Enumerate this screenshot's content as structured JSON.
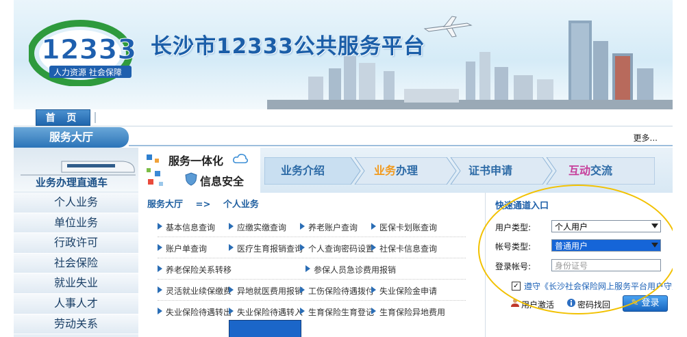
{
  "header": {
    "logo_number": "12333",
    "logo_tagline": "人力资源  社会保障",
    "site_title": "长沙市12333公共服务平台"
  },
  "nav": {
    "home": "首 页"
  },
  "hall": {
    "title": "服务大厅",
    "more": "更多..."
  },
  "sidebar": {
    "train_label": "业务办理直通车",
    "items": [
      "个人业务",
      "单位业务",
      "行政许可",
      "社会保险",
      "就业失业",
      "人事人才",
      "劳动关系"
    ]
  },
  "strip": {
    "badge_line1": "服务一体化",
    "badge_line2": "信息安全",
    "steps": [
      {
        "a": "业务",
        "b": "介绍",
        "hl": false
      },
      {
        "a": "业务",
        "b": "办理",
        "hl": true
      },
      {
        "a": "证书",
        "b": "申请",
        "hl": false
      },
      {
        "a": "互动",
        "b": "交流",
        "hl": false
      }
    ]
  },
  "breadcrumb": {
    "root": "服务大厅",
    "arrow": "=>",
    "current": "个人业务"
  },
  "services": [
    [
      "基本信息查询",
      "应缴实缴查询",
      "养老账户查询",
      "医保卡划账查询"
    ],
    [
      "账户单查询",
      "医疗生育报销查询",
      "个人查询密码设置",
      "社保卡信息查询"
    ],
    [
      "养老保险关系转移",
      "参保人员急诊费用报销"
    ],
    [
      "灵活就业续保缴费",
      "异地就医费用报销",
      "工伤保险待遇拨付",
      "失业保险金申请"
    ],
    [
      "失业保险待遇转出",
      "失业保险待遇转入",
      "生育保险生育登记",
      "生育保险异地费用"
    ]
  ],
  "quick": {
    "title": "快速通道入口",
    "user_type_label": "用户类型:",
    "user_type_value": "个人用户",
    "account_type_label": "帐号类型:",
    "account_type_value": "普通用户",
    "login_label": "登录帐号:",
    "login_placeholder": "身份证号",
    "agree_text": "遵守《长沙社会保险网上服务平台用户守则》",
    "activate": "用户激活",
    "recover": "密码找回",
    "login_button": "登录"
  }
}
